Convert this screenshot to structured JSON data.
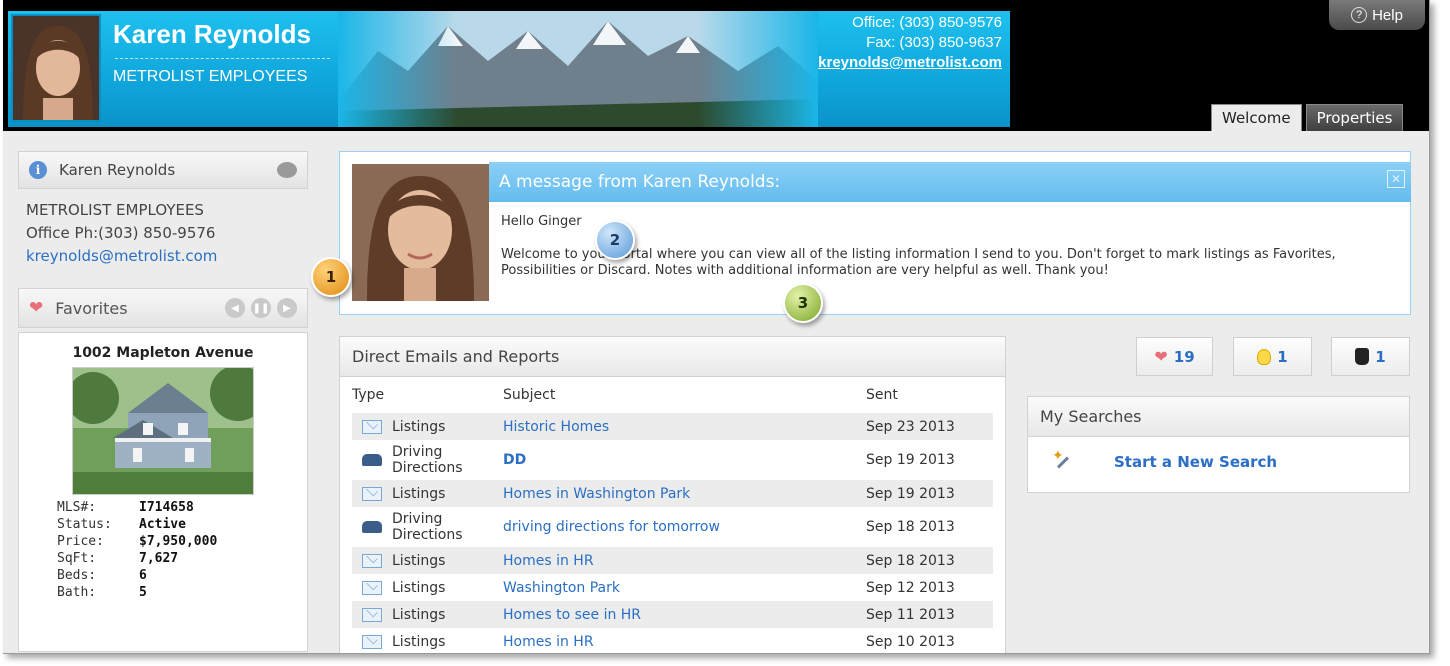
{
  "header": {
    "agent_name": "Karen Reynolds",
    "agent_company": "METROLIST EMPLOYEES",
    "office": "Office: (303) 850-9576",
    "fax": "Fax: (303) 850-9637",
    "email": "kreynolds@metrolist.com",
    "help_label": "Help",
    "tabs": [
      {
        "label": "Welcome",
        "active": true
      },
      {
        "label": "Properties",
        "active": false
      }
    ]
  },
  "sidebar": {
    "agent_name": "Karen Reynolds",
    "company": "METROLIST EMPLOYEES",
    "office_phone": "Office Ph:(303) 850-9576",
    "email": "kreynolds@metrolist.com",
    "favorites_label": "Favorites",
    "favorite": {
      "address": "1002 Mapleton Avenue",
      "fields": [
        {
          "key": "MLS#:",
          "value": "I714658"
        },
        {
          "key": "Status:",
          "value": "Active"
        },
        {
          "key": "Price:",
          "value": "$7,950,000"
        },
        {
          "key": "SqFt:",
          "value": "7,627"
        },
        {
          "key": "Beds:",
          "value": "6"
        },
        {
          "key": "Bath:",
          "value": "5"
        }
      ]
    }
  },
  "message": {
    "title": "A message from Karen Reynolds:",
    "greeting": "Hello Ginger",
    "body": "Welcome to your Portal where you can view all of the listing information I send to you. Don't forget to mark listings as Favorites, Possibilities or Discard. Notes with additional information are very helpful as well. Thank you!",
    "close_label": "✕"
  },
  "callouts": [
    "1",
    "2",
    "3"
  ],
  "emails": {
    "title": "Direct Emails and Reports",
    "columns": [
      "Type",
      "Subject",
      "Sent"
    ],
    "rows": [
      {
        "type": "Listings",
        "icon": "mail-icon",
        "subject": "Historic Homes",
        "sent": "Sep 23 2013"
      },
      {
        "type": "Driving Directions",
        "icon": "car-icon",
        "subject": "DD",
        "sent": "Sep 19 2013"
      },
      {
        "type": "Listings",
        "icon": "mail-icon",
        "subject": "Homes in Washington Park",
        "sent": "Sep 19 2013"
      },
      {
        "type": "Driving Directions",
        "icon": "car-icon",
        "subject": "driving directions for tomorrow",
        "sent": "Sep 18 2013"
      },
      {
        "type": "Listings",
        "icon": "mail-icon",
        "subject": "Homes in HR",
        "sent": "Sep 18 2013"
      },
      {
        "type": "Listings",
        "icon": "mail-icon",
        "subject": "Washington Park",
        "sent": "Sep 12 2013"
      },
      {
        "type": "Listings",
        "icon": "mail-icon",
        "subject": "Homes to see in HR",
        "sent": "Sep 11 2013"
      },
      {
        "type": "Listings",
        "icon": "mail-icon",
        "subject": "Homes in HR",
        "sent": "Sep 10 2013"
      }
    ]
  },
  "counters": {
    "favorites": "19",
    "possibilities": "1",
    "discard": "1"
  },
  "searches": {
    "title": "My Searches",
    "new_search_label": "Start a New Search"
  },
  "colors": {
    "banner": "#1ec0ee",
    "link": "#2a6fc4",
    "message_header": "#63bcef"
  }
}
